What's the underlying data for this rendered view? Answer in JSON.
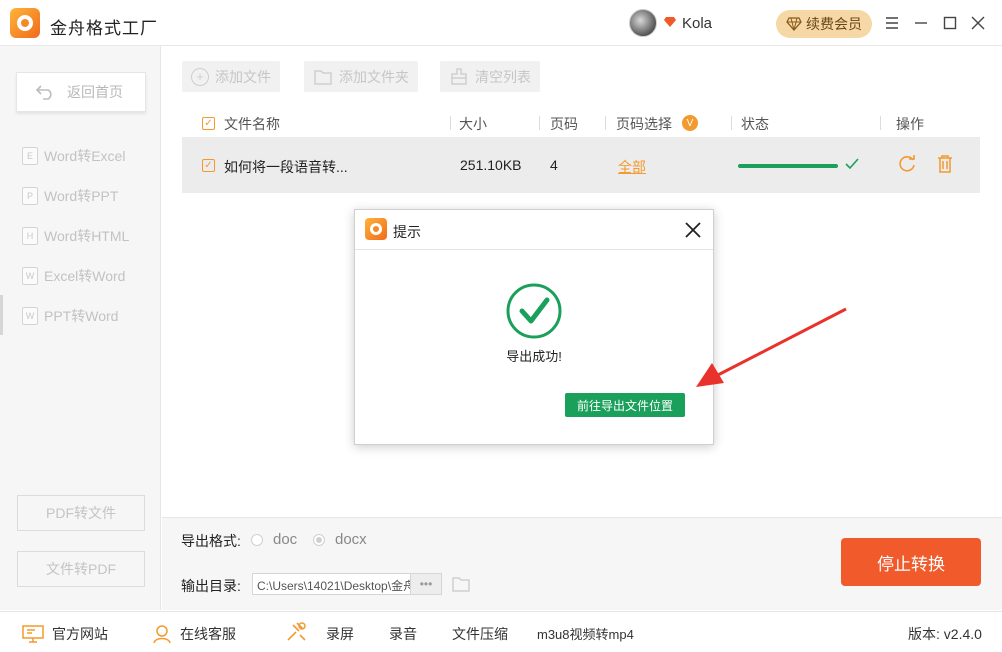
{
  "app": {
    "title": "金舟格式工厂"
  },
  "user": {
    "name": "Kola",
    "renew_label": "续费会员"
  },
  "sidebar": {
    "home_label": "返回首页",
    "items": [
      {
        "label": "Word转Excel",
        "icon": "E"
      },
      {
        "label": "Word转PPT",
        "icon": "P"
      },
      {
        "label": "Word转HTML",
        "icon": "H"
      },
      {
        "label": "Excel转Word",
        "icon": "W"
      },
      {
        "label": "PPT转Word",
        "icon": "W"
      }
    ],
    "pdf_to_file": "PDF转文件",
    "file_to_pdf": "文件转PDF"
  },
  "toolbar": {
    "add_file": "添加文件",
    "add_folder": "添加文件夹",
    "clear_list": "清空列表"
  },
  "table": {
    "headers": {
      "name": "文件名称",
      "size": "大小",
      "pages": "页码",
      "page_select": "页码选择",
      "page_select_badge": "V",
      "status": "状态",
      "actions": "操作"
    },
    "rows": [
      {
        "name": "如何将一段语音转...",
        "size": "251.10KB",
        "pages": "4",
        "page_select": "全部",
        "progress": 1.0
      }
    ]
  },
  "export": {
    "format_label": "导出格式:",
    "formats": [
      "doc",
      "docx"
    ],
    "selected_format": "docx",
    "dir_label": "输出目录:",
    "dir_value": "C:\\Users\\14021\\Desktop\\金舟",
    "browse_label": "•••"
  },
  "stop_button": "停止转换",
  "footer": {
    "website": "官方网站",
    "support": "在线客服",
    "screen_record": "录屏",
    "audio_record": "录音",
    "file_compress": "文件压缩",
    "m3u8": "m3u8视频转mp4",
    "version": "版本: v2.4.0"
  },
  "dialog": {
    "title": "提示",
    "message": "导出成功!",
    "button": "前往导出文件位置"
  },
  "colors": {
    "accent_orange": "#f15a2b",
    "success_green": "#1aa05a",
    "annotation_red": "#e8322b"
  }
}
